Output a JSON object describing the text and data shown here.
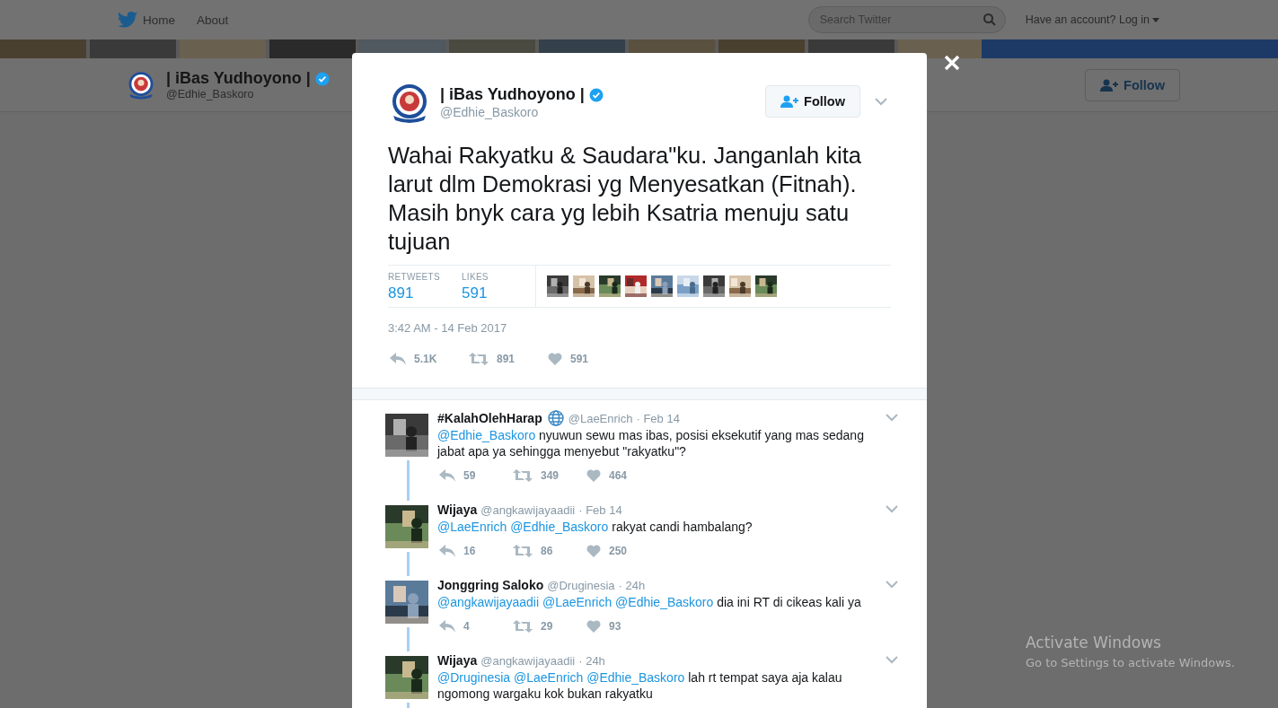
{
  "nav": {
    "items": [
      {
        "label": "Home"
      },
      {
        "label": "About"
      }
    ],
    "search": {
      "placeholder": "Search Twitter"
    },
    "login": "Have an account? Log in"
  },
  "profile_bar": {
    "name": "| iBas Yudhoyono |",
    "handle": "@Edhie_Baskoro",
    "verified": true,
    "follow": "Follow"
  },
  "tweet": {
    "name": "| iBas Yudhoyono |",
    "handle": "@Edhie_Baskoro",
    "verified": true,
    "follow": "Follow",
    "text": "Wahai Rakyatku & Saudara\"ku. Janganlah kita larut dlm Demokrasi yg Menyesatkan (Fitnah). Masih bnyk cara yg lebih Ksatria menuju satu tujuan",
    "stats": [
      {
        "label": "RETWEETS",
        "value": "891"
      },
      {
        "label": "LIKES",
        "value": "591"
      }
    ],
    "time": "3:42 AM - 14 Feb 2017",
    "actions": [
      {
        "kind": "reply",
        "count": "5.1K"
      },
      {
        "kind": "retweet",
        "count": "891"
      },
      {
        "kind": "like",
        "count": "591"
      }
    ]
  },
  "replies": [
    {
      "name": "#KalahOlehHarap",
      "globe": true,
      "handle": "@LaeEnrich",
      "time": "· Feb 14",
      "parts": [
        {
          "kind": "mention",
          "text": "@Edhie_Baskoro"
        },
        {
          "kind": "text",
          "text": " nyuwun sewu mas ibas, posisi eksekutif yang mas sedang jabat apa ya sehingga menyebut \"rakyatku\"?"
        }
      ],
      "actions": [
        {
          "kind": "reply",
          "count": "59"
        },
        {
          "kind": "retweet",
          "count": "349"
        },
        {
          "kind": "like",
          "count": "464"
        }
      ]
    },
    {
      "name": "Wijaya",
      "globe": false,
      "handle": "@angkawijayaadii",
      "time": "· Feb 14",
      "parts": [
        {
          "kind": "mention",
          "text": "@LaeEnrich"
        },
        {
          "kind": "mention",
          "text": "@Edhie_Baskoro"
        },
        {
          "kind": "text",
          "text": " rakyat candi hambalang?"
        }
      ],
      "actions": [
        {
          "kind": "reply",
          "count": "16"
        },
        {
          "kind": "retweet",
          "count": "86"
        },
        {
          "kind": "like",
          "count": "250"
        }
      ]
    },
    {
      "name": "Jonggring Saloko",
      "globe": false,
      "handle": "@Druginesia",
      "time": "· 24h",
      "parts": [
        {
          "kind": "mention",
          "text": "@angkawijayaadii"
        },
        {
          "kind": "mention",
          "text": "@LaeEnrich"
        },
        {
          "kind": "mention",
          "text": "@Edhie_Baskoro"
        },
        {
          "kind": "text",
          "text": " dia ini RT di cikeas kali ya"
        }
      ],
      "actions": [
        {
          "kind": "reply",
          "count": "4"
        },
        {
          "kind": "retweet",
          "count": "29"
        },
        {
          "kind": "like",
          "count": "93"
        }
      ]
    },
    {
      "name": "Wijaya",
      "globe": false,
      "handle": "@angkawijayaadii",
      "time": "· 24h",
      "parts": [
        {
          "kind": "mention",
          "text": "@Druginesia"
        },
        {
          "kind": "mention",
          "text": "@LaeEnrich"
        },
        {
          "kind": "mention",
          "text": "@Edhie_Baskoro"
        },
        {
          "kind": "text",
          "text": " lah rt tempat saya aja kalau ngomong wargaku kok bukan rakyatku"
        }
      ]
    }
  ],
  "os_notice": {
    "title": "Activate Windows",
    "subtitle": "Go to Settings to activate Windows."
  }
}
